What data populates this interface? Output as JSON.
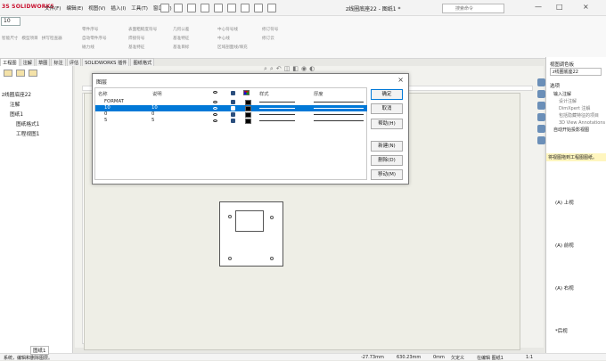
{
  "app": {
    "brand": "3S SOLIDWORKS",
    "window_title": "z线圈底座22 - 图纸1 *",
    "search_placeholder": "搜索命令"
  },
  "menu": [
    "文件(F)",
    "编辑(E)",
    "视图(V)",
    "插入(I)",
    "工具(T)",
    "窗口(W)"
  ],
  "toolbar": {
    "font_size_value": "10",
    "groups": [
      [
        "智能尺寸",
        "模型项目",
        "拼写检查器"
      ],
      [
        "零件序号",
        "自动零件序号",
        "磁力线"
      ],
      [
        "表面粗糙度符号",
        "焊接符号",
        "基准特征"
      ],
      [
        "几何公差",
        "基准特征",
        "基准目标"
      ],
      [
        "中心符号线",
        "中心线",
        "区域剖面线/填充"
      ],
      [
        "修订符号",
        "修订云"
      ]
    ]
  },
  "tabs": [
    "工程图",
    "注解",
    "草图",
    "标注",
    "评估",
    "SOLIDWORKS 插件",
    "图纸格式"
  ],
  "tree": {
    "root": "z线圈底座22",
    "items": [
      "注解",
      "图纸1",
      "图纸格式1",
      "工程视图1"
    ]
  },
  "dialog": {
    "title": "图层",
    "headers": [
      "名称",
      "说明",
      "",
      "",
      "",
      "样式",
      "厚度"
    ],
    "rows": [
      {
        "name": "FORMAT",
        "desc": "",
        "selected": false
      },
      {
        "name": "10",
        "desc": "10",
        "selected": true
      },
      {
        "name": "0",
        "desc": "0",
        "selected": false
      },
      {
        "name": "5",
        "desc": "5",
        "selected": false
      }
    ],
    "buttons": [
      "确定",
      "取消",
      "帮助(H)",
      "新建(N)",
      "删除(D)",
      "移动(M)"
    ]
  },
  "right": {
    "title": "视图调色板",
    "dropdown": "z线圈底座22",
    "section": "选项",
    "options": [
      "输入注解",
      "设计注解",
      "DimXpert 注解",
      "包括隐藏特征的项目",
      "3D View Annotations",
      "自动开始投影视图"
    ],
    "hint": "将视图拖到工程图图纸。",
    "views": [
      "(A) 上视",
      "(A) 前视",
      "(A) 右视",
      "*后视"
    ]
  },
  "status_bar": {
    "left": "系统，编辑和删除图层。",
    "x": "-27.73mm",
    "y": "630.23mm",
    "z": "0mm",
    "state": "欠定义",
    "edit": "在编辑 图纸1",
    "zoom": "1:1"
  },
  "sheet_tab": "图纸1"
}
